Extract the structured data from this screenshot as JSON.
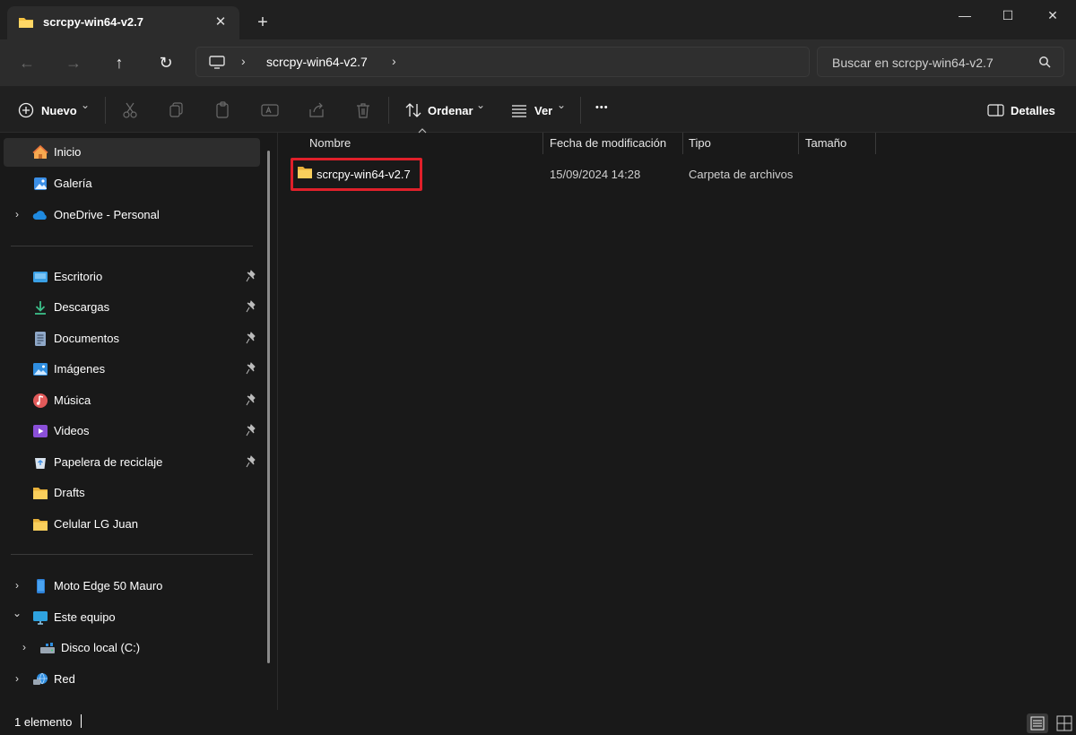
{
  "window": {
    "tab_title": "scrcpy-win64-v2.7",
    "tab_close": "✕",
    "new_tab": "+",
    "minimize": "—",
    "maximize": "☐",
    "close": "✕"
  },
  "nav": {
    "back": "←",
    "forward": "→",
    "up": "↑",
    "refresh": "↻"
  },
  "address": {
    "separator": "›",
    "crumb": "scrcpy-win64-v2.7"
  },
  "search": {
    "placeholder": "Buscar en scrcpy-win64-v2.7"
  },
  "toolbar": {
    "new_label": "Nuevo",
    "sort_label": "Ordenar",
    "view_label": "Ver",
    "more_label": "•••",
    "details_label": "Detalles",
    "dropdown": "⌄"
  },
  "sidebar": {
    "quick": [
      {
        "label": "Inicio",
        "icon": "home-icon"
      },
      {
        "label": "Galería",
        "icon": "gallery-icon"
      },
      {
        "label": "OneDrive - Personal",
        "icon": "cloud-icon"
      }
    ],
    "pinned": [
      {
        "label": "Escritorio",
        "icon": "desktop-icon"
      },
      {
        "label": "Descargas",
        "icon": "download-icon"
      },
      {
        "label": "Documentos",
        "icon": "document-icon"
      },
      {
        "label": "Imágenes",
        "icon": "image-icon"
      },
      {
        "label": "Música",
        "icon": "music-icon"
      },
      {
        "label": "Videos",
        "icon": "video-icon"
      },
      {
        "label": "Papelera de reciclaje",
        "icon": "recycle-bin-icon"
      }
    ],
    "folders": [
      {
        "label": "Drafts",
        "icon": "folder-icon"
      },
      {
        "label": "Celular LG Juan",
        "icon": "folder-icon"
      }
    ],
    "devices": [
      {
        "label": "Moto Edge 50 Mauro",
        "icon": "phone-icon"
      },
      {
        "label": "Este equipo",
        "icon": "computer-icon"
      },
      {
        "label": "Disco local (C:)",
        "icon": "drive-icon"
      },
      {
        "label": "Red",
        "icon": "network-icon"
      }
    ],
    "chevron_right": "›",
    "chevron_down": "⌄"
  },
  "columns": {
    "name": "Nombre",
    "modified": "Fecha de modificación",
    "type": "Tipo",
    "size": "Tamaño"
  },
  "files": [
    {
      "name": "scrcpy-win64-v2.7",
      "modified": "15/09/2024 14:28",
      "type": "Carpeta de archivos",
      "size": ""
    }
  ],
  "status": {
    "count": "1 elemento"
  },
  "colors": {
    "accent_highlight": "#e0202a",
    "folder": "#f6c342"
  }
}
